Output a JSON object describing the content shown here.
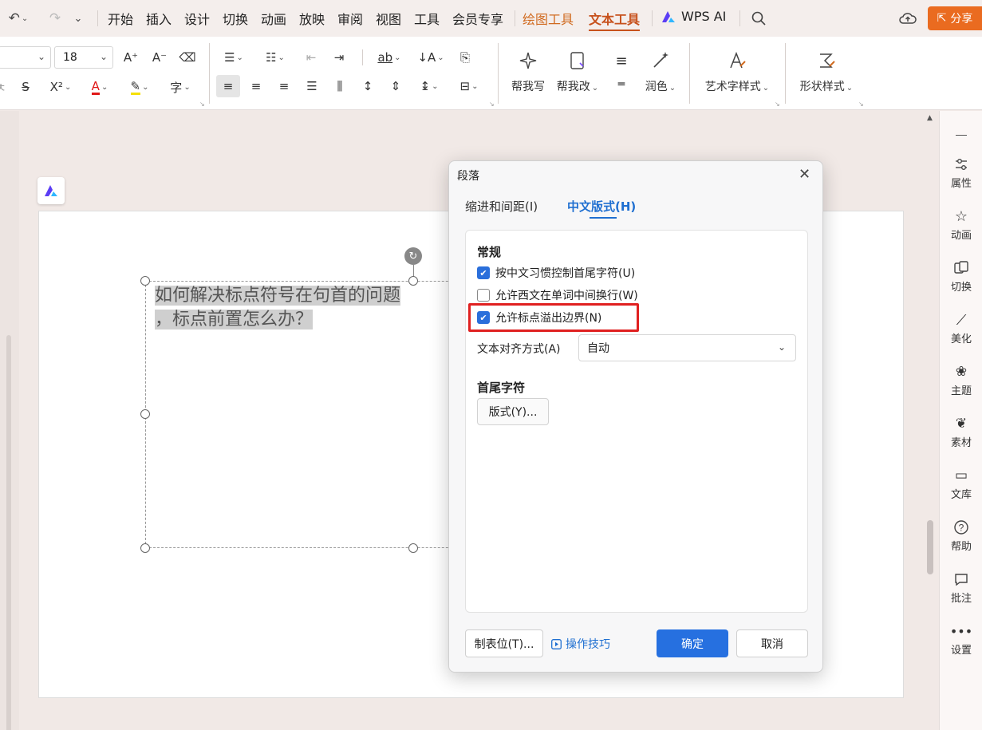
{
  "menubar": {
    "tabs": [
      "开始",
      "插入",
      "设计",
      "切换",
      "动画",
      "放映",
      "审阅",
      "视图",
      "工具",
      "会员专享"
    ],
    "context_tabs": [
      "绘图工具",
      "文本工具"
    ],
    "active_tab": "文本工具",
    "ai_label": "WPS AI",
    "share_label": "分享"
  },
  "ribbon": {
    "font_size": "18",
    "help_write": "帮我写",
    "help_edit": "帮我改",
    "polish": "润色",
    "art_style": "艺术字样式",
    "shape_style": "形状样式"
  },
  "slide": {
    "line1": "如何解决标点符号在句首的问题",
    "line2": "，标点前置怎么办？"
  },
  "right_panel": [
    "属性",
    "动画",
    "切换",
    "美化",
    "主题",
    "素材",
    "文库",
    "帮助",
    "批注",
    "设置"
  ],
  "dialog": {
    "title": "段落",
    "tabs": [
      "缩进和间距(I)",
      "中文版式(H)"
    ],
    "section_general": "常规",
    "options": [
      {
        "label": "按中文习惯控制首尾字符(U)",
        "checked": true
      },
      {
        "label": "允许西文在单词中间换行(W)",
        "checked": false
      },
      {
        "label": "允许标点溢出边界(N)",
        "checked": true
      }
    ],
    "align_label": "文本对齐方式(A)",
    "align_value": "自动",
    "section_firstlast": "首尾字符",
    "style_button": "版式(Y)...",
    "tab_stops_button": "制表位(T)...",
    "tips_link": "操作技巧",
    "ok": "确定",
    "cancel": "取消"
  },
  "colors": {
    "accent": "#2670e0",
    "context_tab": "#c7511c",
    "share": "#ea6b20",
    "highlight_box": "#e02020"
  }
}
